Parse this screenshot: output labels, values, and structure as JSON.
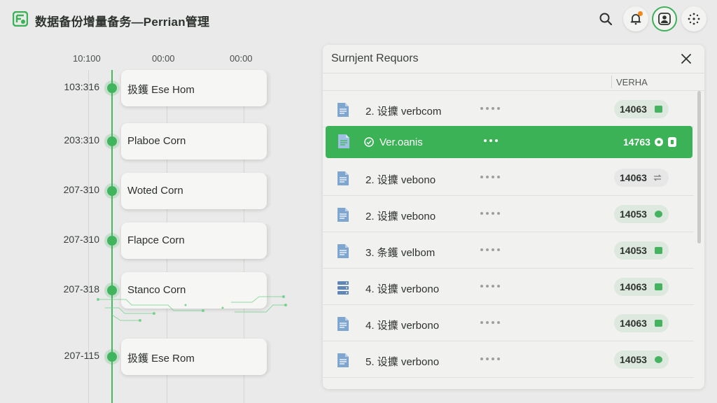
{
  "header": {
    "title": "数据备份增量备务—Perrian管理",
    "icons": {
      "logo": "app-logo-icon",
      "search": "search-icon",
      "bell": "bell-icon",
      "user": "user-icon",
      "settings": "gear-icon"
    },
    "colors": {
      "accent": "#3cb257",
      "notify": "#f08a1c"
    }
  },
  "timeline": {
    "time_labels": [
      "10:100",
      "00:00",
      "00:00"
    ],
    "items": [
      {
        "id": "103:316",
        "label": "扱鑊 Ese Hom"
      },
      {
        "id": "203:310",
        "label": "Plaboe Corn"
      },
      {
        "id": "207-310",
        "label": "Woted Corn"
      },
      {
        "id": "207-310",
        "label": "Flapce Corn"
      },
      {
        "id": "207-318",
        "label": "Stanco Corn"
      },
      {
        "id": "207-115",
        "label": "扱鑊 Ese Rom"
      }
    ]
  },
  "panel": {
    "title": "Surnjent Requors",
    "column": "VERHA",
    "rows": [
      {
        "label": "2.  设攈 verbcom",
        "value": "14063",
        "status": "green"
      },
      {
        "label": "Ver.oanis",
        "value": "14763",
        "status": "selected"
      },
      {
        "label": "2.  设攈 vebono",
        "value": "14063",
        "status": "gray"
      },
      {
        "label": "2.  设攈 vebono",
        "value": "14053",
        "status": "green"
      },
      {
        "label": "3.  条鑊 velbom",
        "value": "14053",
        "status": "green"
      },
      {
        "label": "4.  设攈 verbono",
        "value": "14063",
        "status": "green"
      },
      {
        "label": "4.  设攈 verbono",
        "value": "14063",
        "status": "green"
      },
      {
        "label": "5.  设攈 verbono",
        "value": "14053",
        "status": "green"
      }
    ]
  }
}
